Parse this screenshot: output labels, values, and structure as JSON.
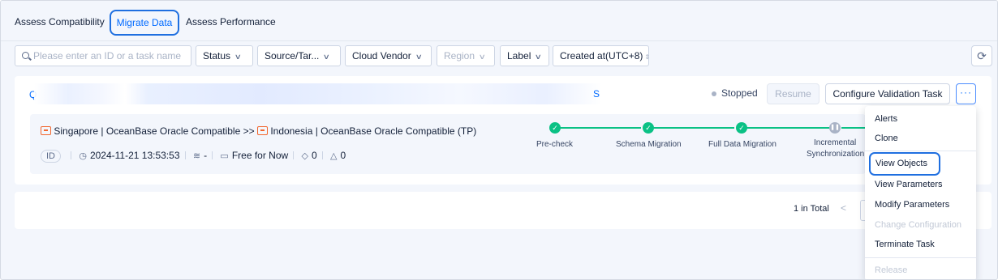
{
  "tabs": [
    "Assess Compatibility",
    "Migrate Data",
    "Assess Performance"
  ],
  "filters": {
    "search_placeholder": "Please enter an ID or a task name",
    "status": "Status",
    "source_target": "Source/Tar...",
    "cloud_vendor": "Cloud Vendor",
    "region": "Region",
    "label": "Label",
    "created_at": "Created at(UTC+8)"
  },
  "task": {
    "name_prefix": "Q",
    "name_suffix": "S",
    "status": "Stopped",
    "resume_label": "Resume",
    "validate_label": "Configure Validation Task",
    "more_label": "···",
    "source_region": "Singapore",
    "source_db": "OceanBase Oracle Compatible",
    "arrow": ">>",
    "target_region": "Indonesia",
    "target_db": "OceanBase Oracle Compatible (TP)",
    "id_badge": "ID",
    "created_time": "2024-11-21 13:53:53",
    "instance_spec": "-",
    "billing": "Free for Now",
    "tag_count": "0",
    "alert_count": "0",
    "steps": [
      "Pre-check",
      "Schema Migration",
      "Full Data Migration",
      "Incremental Synchronization"
    ],
    "incremental_line1": "Incremental",
    "incremental_line2": "Synchronization"
  },
  "pagination": {
    "total": "1 in Total",
    "prev": "<"
  },
  "menu": {
    "alerts": "Alerts",
    "clone": "Clone",
    "view_objects": "View Objects",
    "view_parameters": "View Parameters",
    "modify_parameters": "Modify Parameters",
    "change_configuration": "Change Configuration",
    "terminate_task": "Terminate Task",
    "release": "Release"
  },
  "colors": {
    "accent": "#006aff",
    "success": "#0ac185",
    "source_icon": "#f2662d",
    "muted": "#a9b3c6"
  }
}
